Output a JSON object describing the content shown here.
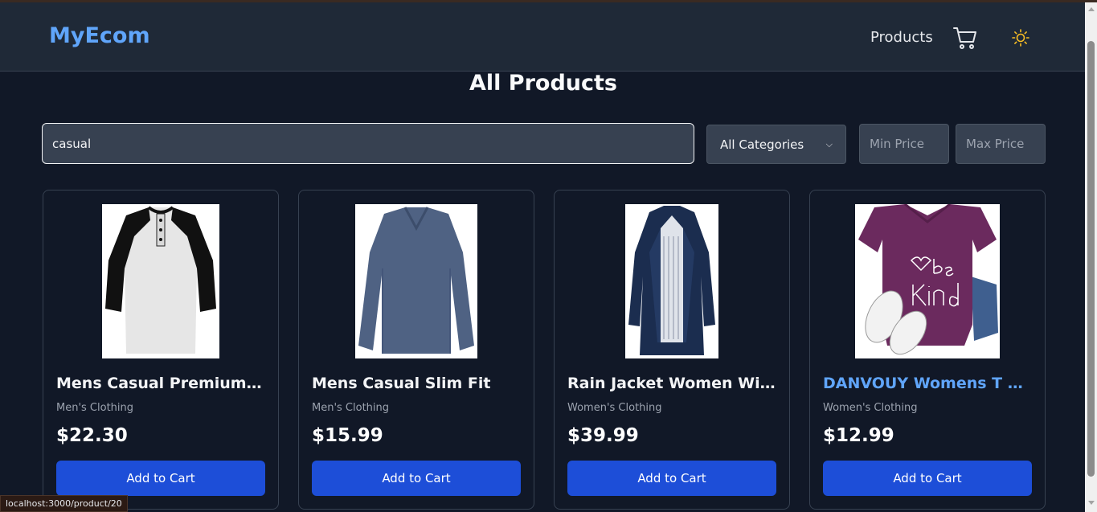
{
  "header": {
    "logo": "MyEcom",
    "nav_products": "Products"
  },
  "main": {
    "title": "All Products",
    "filters": {
      "search_value": "casual",
      "category_selected": "All Categories",
      "min_price_placeholder": "Min Price",
      "max_price_placeholder": "Max Price"
    }
  },
  "products": [
    {
      "title": "Mens Casual Premium Sli...",
      "category": "Men's Clothing",
      "price": "$22.30",
      "button": "Add to Cart"
    },
    {
      "title": "Mens Casual Slim Fit",
      "category": "Men's Clothing",
      "price": "$15.99",
      "button": "Add to Cart"
    },
    {
      "title": "Rain Jacket Women Windb...",
      "category": "Women's Clothing",
      "price": "$39.99",
      "button": "Add to Cart"
    },
    {
      "title": "DANVOUY Womens T Shir...",
      "category": "Women's Clothing",
      "price": "$12.99",
      "button": "Add to Cart"
    }
  ],
  "status_bar": {
    "url": "localhost:3000/product/20"
  },
  "icons": {
    "cart": "cart-icon",
    "theme": "sun-icon"
  },
  "colors": {
    "accent": "#60a5fa",
    "button": "#1d4ed8",
    "background": "#111827",
    "navbar": "#1f2937"
  }
}
